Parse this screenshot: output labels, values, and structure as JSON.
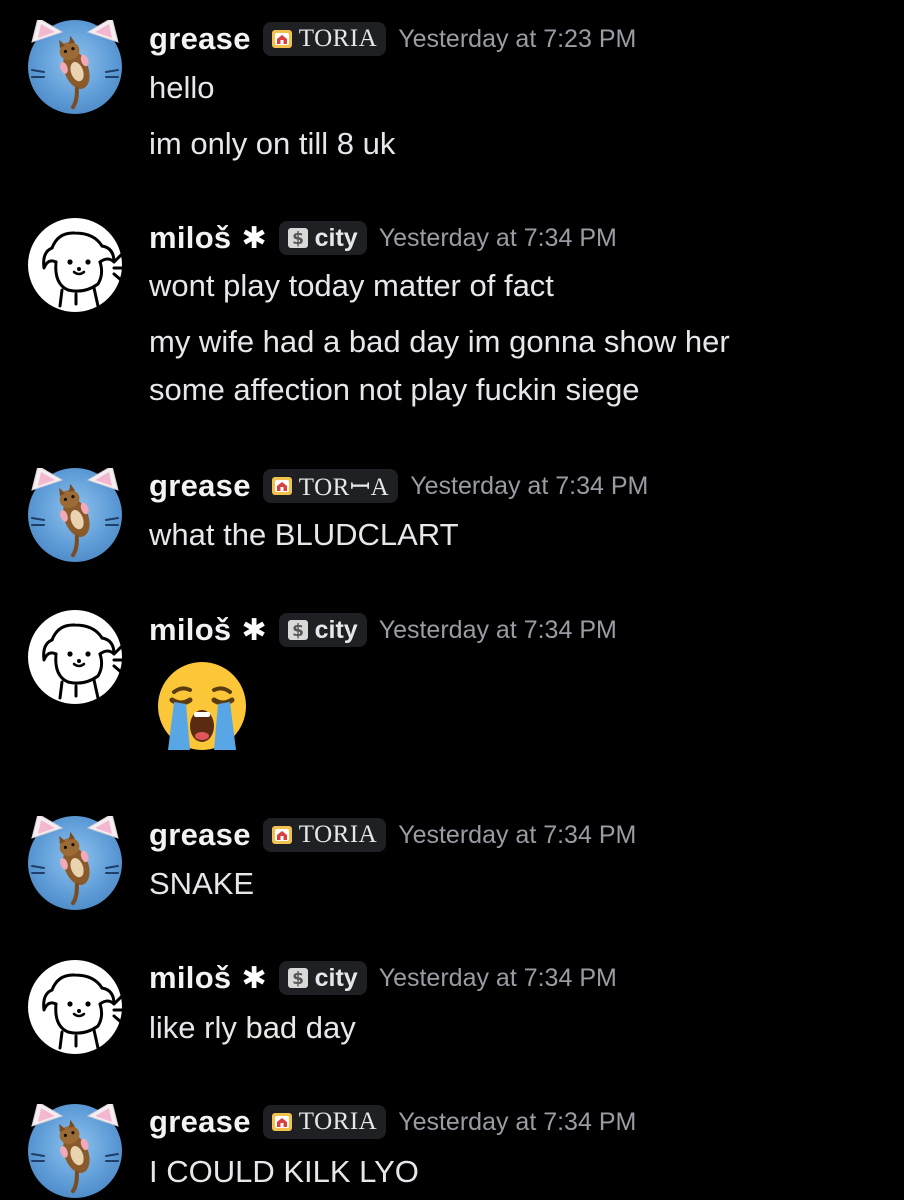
{
  "messages": [
    {
      "author": "grease",
      "role_tag": "TORIA",
      "timestamp": "Yesterday at 7:23 PM",
      "lines": [
        "hello",
        "im only on till 8 uk"
      ]
    },
    {
      "author": "miloš",
      "role_tag": "city",
      "timestamp": "Yesterday at 7:34 PM",
      "lines": [
        "wont play today matter of fact",
        "my wife had a bad day im gonna show her",
        "some affection not play fuckin siege"
      ]
    },
    {
      "author": "grease",
      "role_tag": "TORꟷA",
      "timestamp": "Yesterday at 7:34 PM",
      "lines": [
        "what the BLUDCLART"
      ]
    },
    {
      "author": "miloš",
      "role_tag": "city",
      "timestamp": "Yesterday at 7:34 PM",
      "emoji": "loudly-crying-face"
    },
    {
      "author": "grease",
      "role_tag": "TORIA",
      "timestamp": "Yesterday at 7:34 PM",
      "lines": [
        "SNAKE"
      ]
    },
    {
      "author": "miloš",
      "role_tag": "city",
      "timestamp": "Yesterday at 7:34 PM",
      "lines": [
        "like rly bad day"
      ]
    },
    {
      "author": "grease",
      "role_tag": "TORIA",
      "timestamp": "Yesterday at 7:34 PM",
      "lines": [
        "I COULD KILK LYO"
      ]
    }
  ],
  "colors": {
    "background": "#000000",
    "username": "#f2f3f5",
    "timestamp": "#9a9ca4",
    "message_text": "#e6e7ea",
    "tag_background": "#1f2024",
    "avatar_cat_blue": "#5d9bd6"
  },
  "icons": {
    "grease_avatar": "cat-avatar-icon",
    "milos_avatar": "dog-avatar-icon",
    "toria_tag_icon": "house-icon",
    "city_tag_icon": "dollar-icon",
    "asterisk": "asterisk-icon"
  }
}
